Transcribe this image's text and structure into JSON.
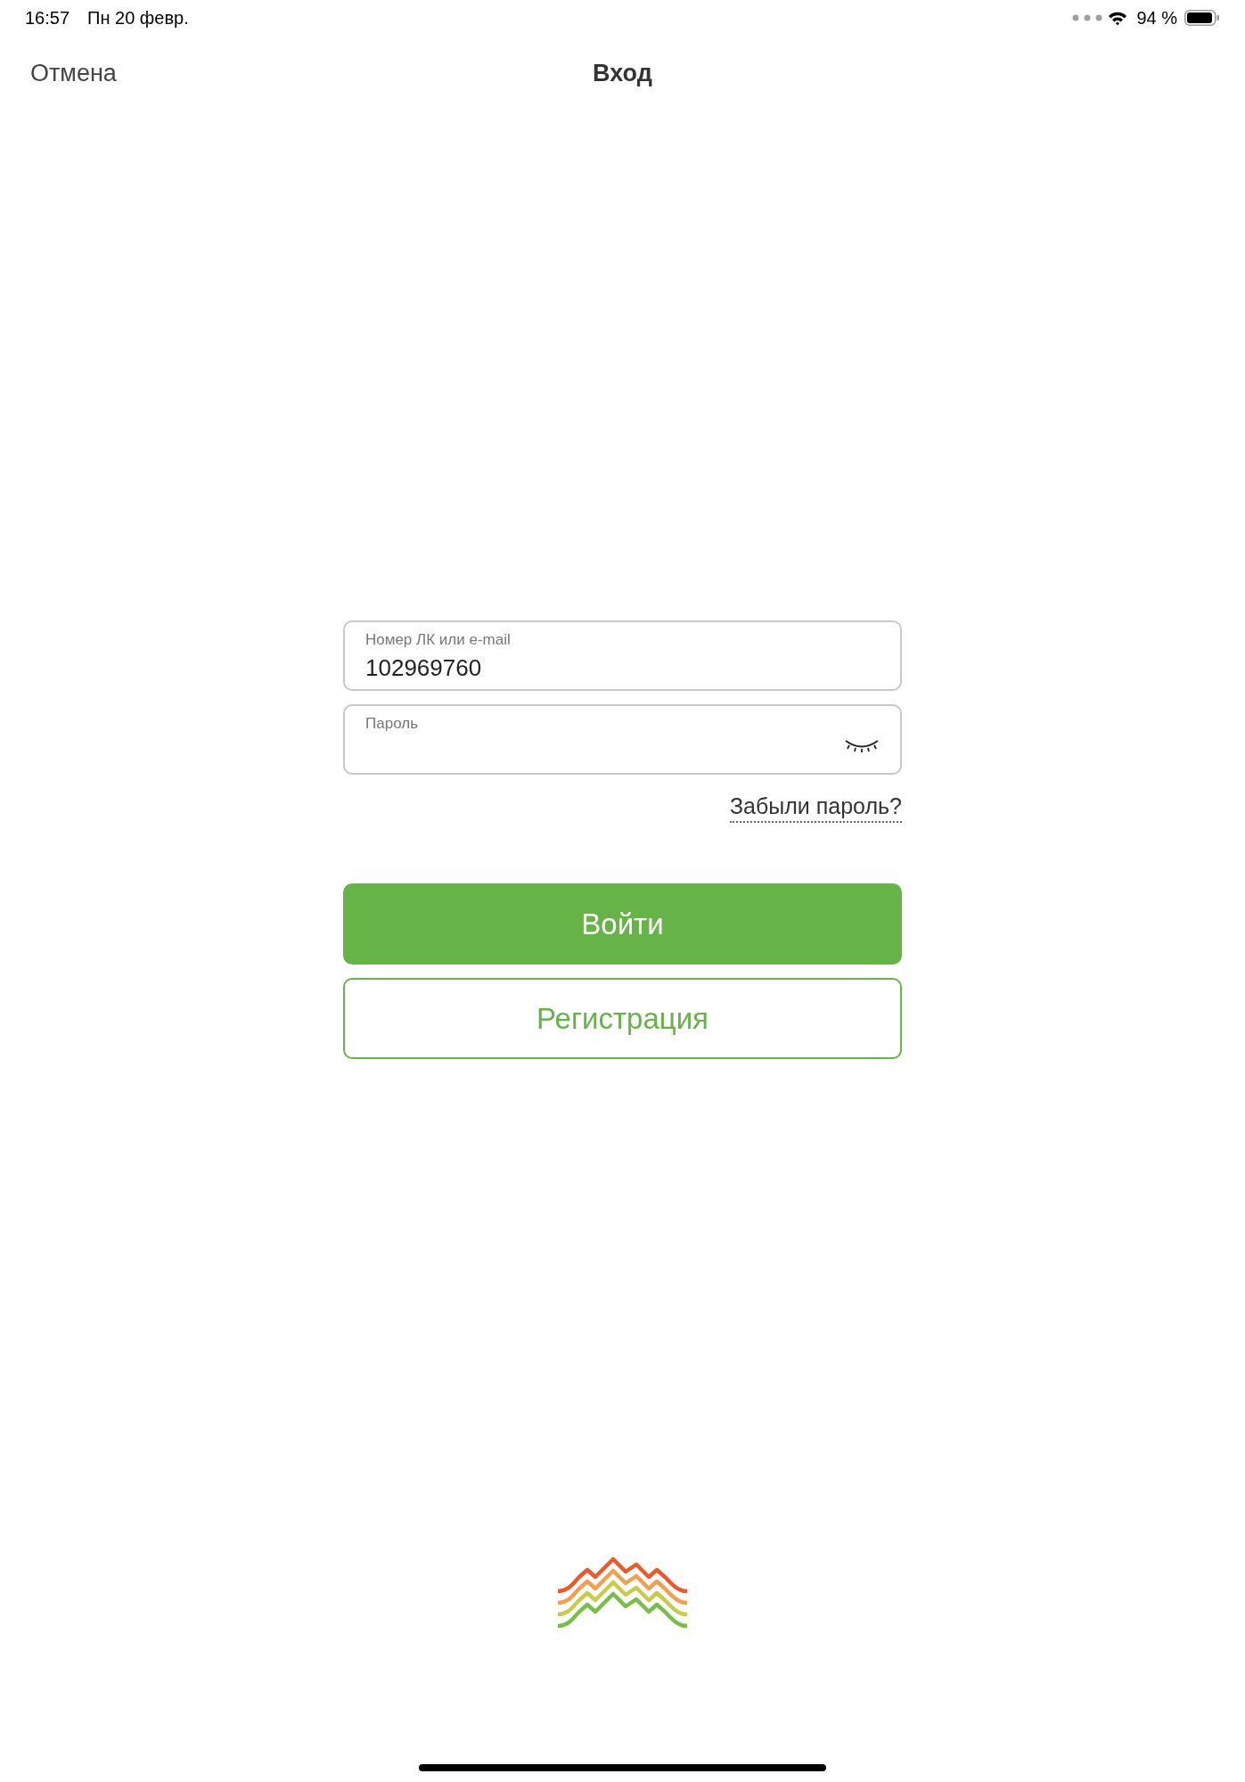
{
  "status_bar": {
    "time": "16:57",
    "date": "Пн 20 февр.",
    "battery": "94 %"
  },
  "nav": {
    "cancel": "Отмена",
    "title": "Вход"
  },
  "fields": [
    {
      "kind": "text",
      "label": "Номер ЛК или e-mail",
      "value": "102969760"
    },
    {
      "kind": "password",
      "label": "Пароль"
    }
  ],
  "forgot_link": "Забыли пароль?",
  "buttons": [
    {
      "kind": "primary",
      "label": "Войти"
    },
    {
      "kind": "outline",
      "label": "Регистрация"
    }
  ]
}
